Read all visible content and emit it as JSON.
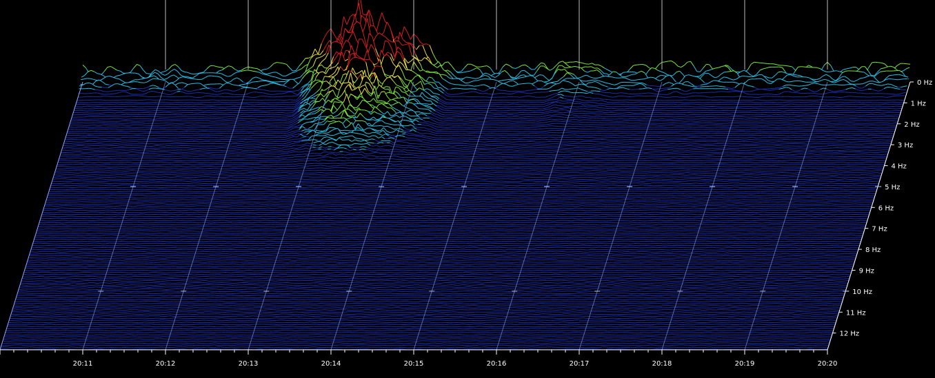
{
  "chart_data": {
    "type": "area",
    "title": "",
    "xlabel": "",
    "ylabel": "",
    "x_ticks": [
      "20:11",
      "20:12",
      "20:13",
      "20:14",
      "20:15",
      "20:16",
      "20:17",
      "20:18",
      "20:19",
      "20:20"
    ],
    "y_ticks": [
      "0 Hz",
      "1 Hz",
      "2 Hz",
      "3 Hz",
      "4 Hz",
      "5 Hz",
      "6 Hz",
      "7 Hz",
      "8 Hz",
      "9 Hz",
      "10 Hz",
      "11 Hz",
      "12 Hz"
    ],
    "xlim": [
      "20:10",
      "20:20"
    ],
    "ylim_hz": [
      0,
      12.8
    ],
    "grid": true,
    "colors": {
      "background": "#000000",
      "low": "#1a2fb0",
      "mid_low": "#27c0e8",
      "mid": "#7de83a",
      "mid_high": "#f2e23a",
      "high": "#d81e1e",
      "axis": "#ffffff"
    },
    "events": [
      {
        "name": "",
        "start": "20:12:40",
        "peak": "20:13:20",
        "end": "20:14:10",
        "max_freq_hz": 4.5,
        "relative_amplitude": 1.0
      },
      {
        "name": "",
        "start": "20:15:40",
        "peak": "20:15:50",
        "end": "20:16:10",
        "max_freq_hz": 3.1,
        "relative_amplitude": 0.15
      }
    ],
    "baseline_low_freq_amplitude": 0.25
  }
}
